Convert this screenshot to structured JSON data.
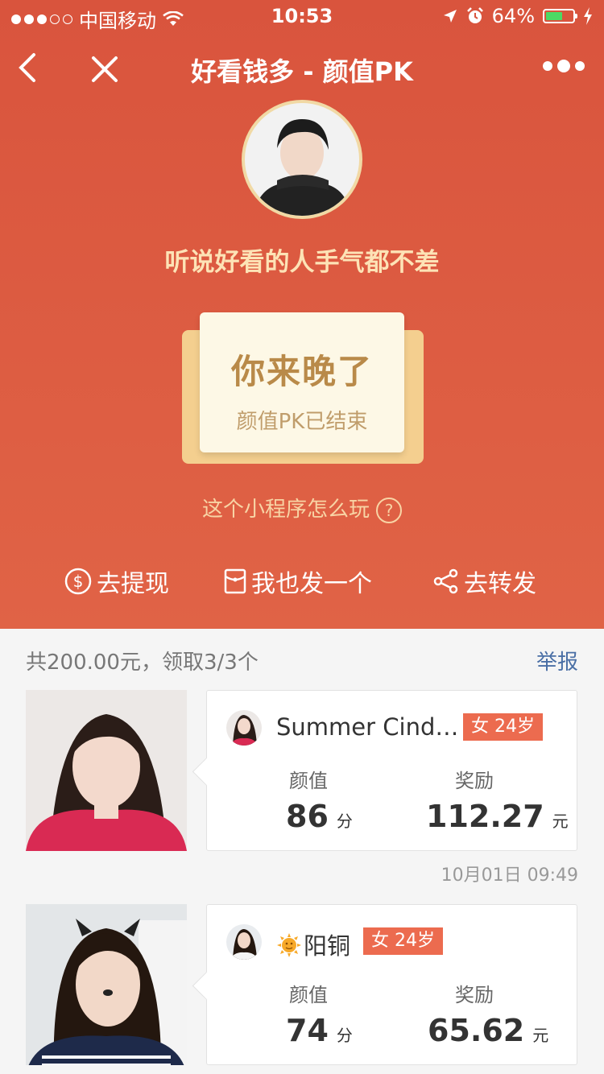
{
  "status_bar": {
    "carrier": "中国移动",
    "time": "10:53",
    "battery": "64%",
    "battery_level": 0.64,
    "icons": [
      "signal-dots",
      "wifi-icon",
      "location-arrow-icon",
      "alarm-icon",
      "battery-icon",
      "charging-bolt-icon"
    ]
  },
  "nav": {
    "title": "好看钱多 - 颜值PK",
    "icons": [
      "back-chevron-icon",
      "close-icon",
      "more-icon"
    ]
  },
  "hero": {
    "slogan": "听说好看的人手气都不差",
    "card_title": "你来晚了",
    "card_subtitle": "颜值PK已结束",
    "howto": "这个小程序怎么玩",
    "howto_icon": "?"
  },
  "actions": [
    {
      "label": "去提现",
      "icon": "dollar-circle-icon"
    },
    {
      "label": "我也发一个",
      "icon": "envelope-icon"
    },
    {
      "label": "去转发",
      "icon": "share-icon"
    }
  ],
  "summary": {
    "text": "共200.00元，领取3/3个",
    "report": "举报"
  },
  "entries": [
    {
      "name": "Summer Cind…",
      "badge": "女 24岁",
      "beauty_label": "颜值",
      "beauty_value": "86",
      "beauty_unit": "分",
      "reward_label": "奖励",
      "reward_value": "112.27",
      "reward_unit": "元",
      "timestamp": "10月01日  09:49"
    },
    {
      "name": "阳铜",
      "name_prefix_icon": "sun-emoji-icon",
      "badge": "女 24岁",
      "beauty_label": "颜值",
      "beauty_value": "74",
      "beauty_unit": "分",
      "reward_label": "奖励",
      "reward_value": "65.62",
      "reward_unit": "元"
    }
  ],
  "colors": {
    "hero_red": "#d9543d",
    "accent_orange": "#ec6b4f",
    "gold_text": "#b98a49",
    "link_blue": "#4a6fa5"
  }
}
